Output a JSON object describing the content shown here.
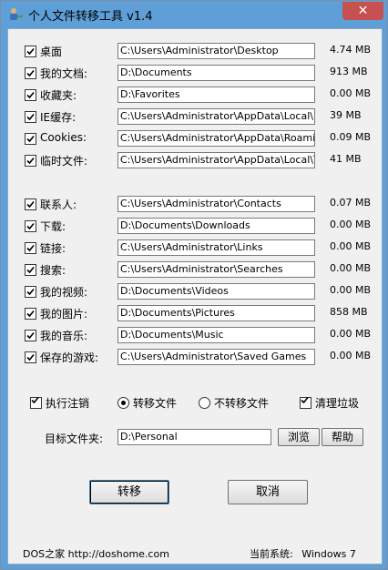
{
  "window": {
    "title": "个人文件转移工具 v1.4",
    "close_glyph": "✕"
  },
  "items": [
    {
      "label": "桌面",
      "path": "C:\\Users\\Administrator\\Desktop",
      "size": "4.74 MB",
      "checked": true
    },
    {
      "label": "我的文档:",
      "path": "D:\\Documents",
      "size": "913 MB",
      "checked": true
    },
    {
      "label": "收藏夹:",
      "path": "D:\\Favorites",
      "size": "0.00 MB",
      "checked": true
    },
    {
      "label": "IE缓存:",
      "path": "C:\\Users\\Administrator\\AppData\\Local\\Microsoft",
      "size": "39 MB",
      "checked": true
    },
    {
      "label": "Cookies:",
      "path": "C:\\Users\\Administrator\\AppData\\Roaming\\Microsoft",
      "size": "0.09 MB",
      "checked": true
    },
    {
      "label": "临时文件:",
      "path": "C:\\Users\\Administrator\\AppData\\Local\\Temp",
      "size": "41 MB",
      "checked": true
    },
    {
      "label": "联系人:",
      "path": "C:\\Users\\Administrator\\Contacts",
      "size": "0.07 MB",
      "checked": true
    },
    {
      "label": "下载:",
      "path": "D:\\Documents\\Downloads",
      "size": "0.00 MB",
      "checked": true
    },
    {
      "label": "链接:",
      "path": "C:\\Users\\Administrator\\Links",
      "size": "0.00 MB",
      "checked": true
    },
    {
      "label": "搜索:",
      "path": "C:\\Users\\Administrator\\Searches",
      "size": "0.00 MB",
      "checked": true
    },
    {
      "label": "我的视频:",
      "path": "D:\\Documents\\Videos",
      "size": "0.00 MB",
      "checked": true
    },
    {
      "label": "我的图片:",
      "path": "D:\\Documents\\Pictures",
      "size": "858 MB",
      "checked": true
    },
    {
      "label": "我的音乐:",
      "path": "D:\\Documents\\Music",
      "size": "0.00 MB",
      "checked": true
    },
    {
      "label": "保存的游戏:",
      "path": "C:\\Users\\Administrator\\Saved Games",
      "size": "0.00 MB",
      "checked": true
    }
  ],
  "options": {
    "logoff": {
      "label": "执行注销",
      "checked": true
    },
    "transfer": {
      "label": "转移文件",
      "selected": true
    },
    "no_transfer": {
      "label": "不转移文件",
      "selected": false
    },
    "cleanup": {
      "label": "清理垃圾",
      "checked": true
    }
  },
  "target": {
    "label": "目标文件夹:",
    "value": "D:\\Personal",
    "browse_label": "浏览",
    "help_label": "帮助"
  },
  "actions": {
    "transfer_label": "转移",
    "cancel_label": "取消"
  },
  "footer": {
    "site": "DOS之家  http://doshome.com",
    "system_label": "当前系统:",
    "system_value": "Windows 7"
  }
}
